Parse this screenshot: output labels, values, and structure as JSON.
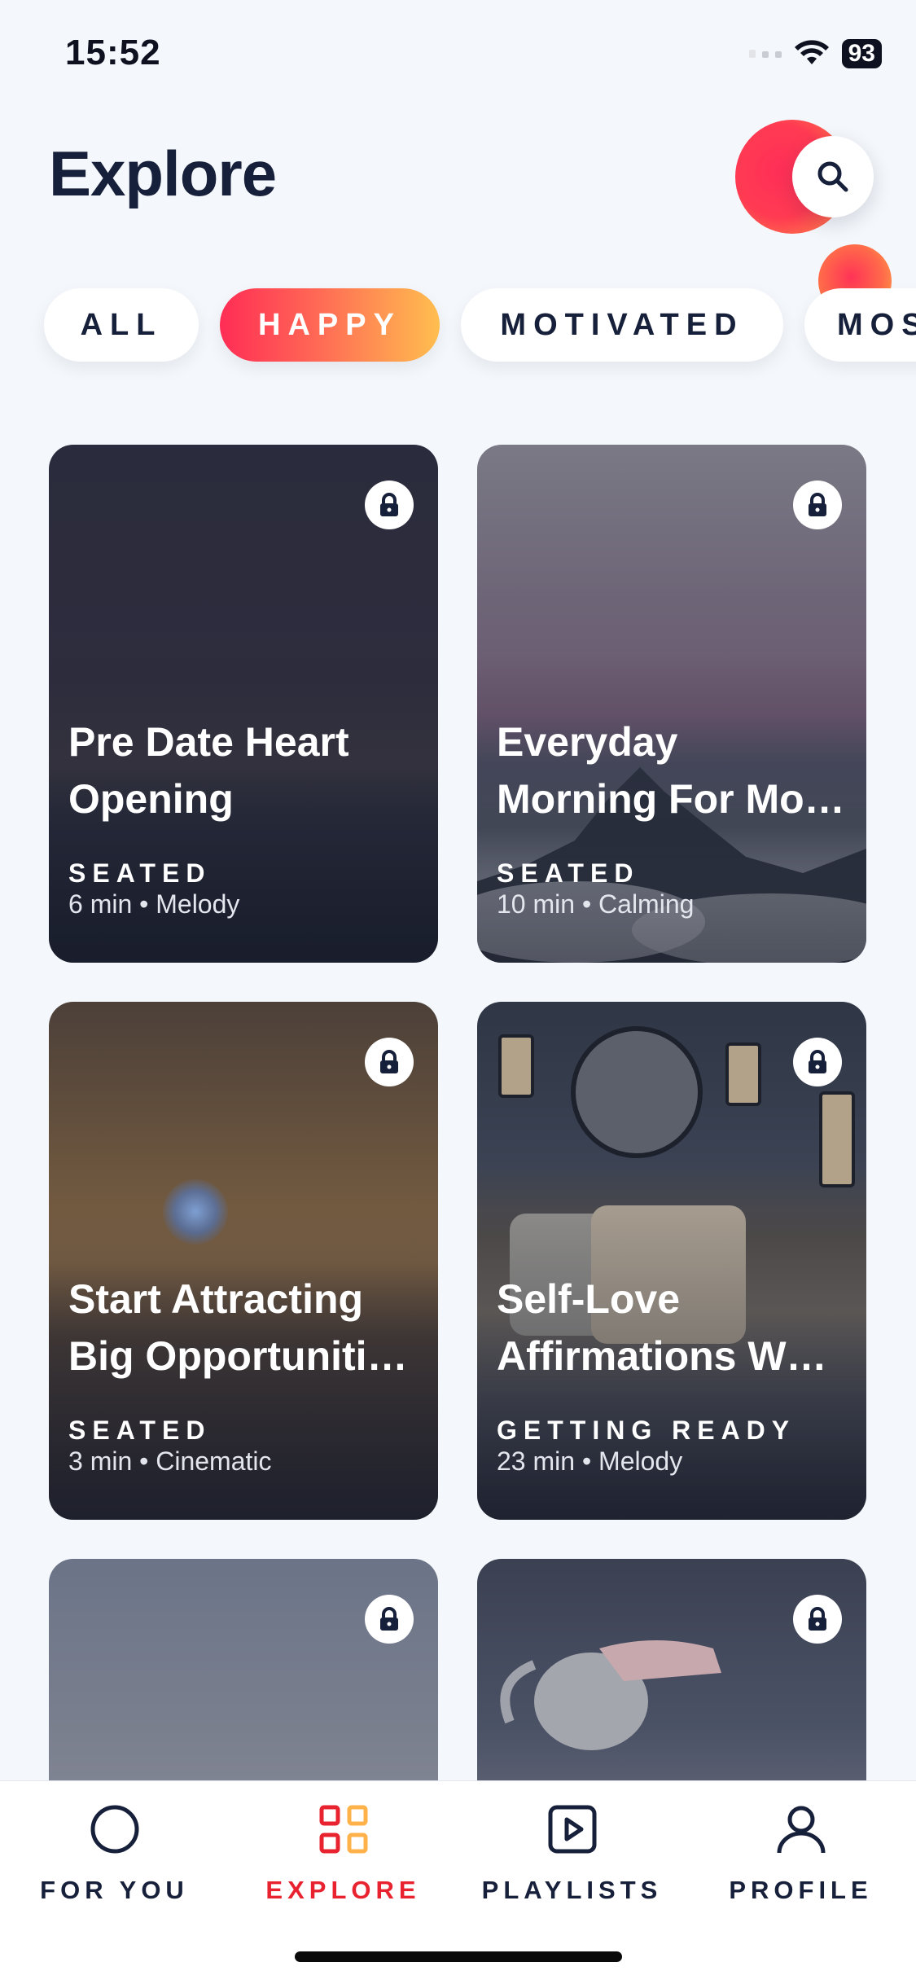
{
  "status_bar": {
    "time": "15:52",
    "battery": "93",
    "icons": [
      "signal-icon",
      "wifi-icon",
      "battery-icon"
    ]
  },
  "header": {
    "title": "Explore",
    "search_icon": "search-icon"
  },
  "filters": [
    {
      "label": "ALL",
      "active": false
    },
    {
      "label": "HAPPY",
      "active": true
    },
    {
      "label": "MOTIVATED",
      "active": false
    },
    {
      "label": "MOS",
      "active": false
    }
  ],
  "cards": [
    {
      "title": "Pre Date Heart Opening",
      "category": "SEATED",
      "meta": "6 min • Melody",
      "locked": true
    },
    {
      "title": "Everyday Morning For Mo…",
      "category": "SEATED",
      "meta": "10 min • Calming",
      "locked": true
    },
    {
      "title": "Start Attracting Big Opportuniti…",
      "category": "SEATED",
      "meta": "3 min • Cinematic",
      "locked": true
    },
    {
      "title": "Self-Love Affirmations W…",
      "category": "GETTING READY",
      "meta": "23 min • Melody",
      "locked": true
    },
    {
      "title": "",
      "category": "",
      "meta": "",
      "locked": true
    },
    {
      "title": "",
      "category": "",
      "meta": "",
      "locked": true
    }
  ],
  "nav": [
    {
      "label": "FOR YOU",
      "icon": "circle-icon",
      "active": false
    },
    {
      "label": "EXPLORE",
      "icon": "grid-icon",
      "active": true
    },
    {
      "label": "PLAYLISTS",
      "icon": "play-square-icon",
      "active": false
    },
    {
      "label": "PROFILE",
      "icon": "user-icon",
      "active": false
    }
  ],
  "colors": {
    "accent_red": "#e8232f",
    "gradient_start": "#ff2d55",
    "gradient_end": "#ffbe4f",
    "navy": "#17203a",
    "background": "#f4f7fb"
  }
}
